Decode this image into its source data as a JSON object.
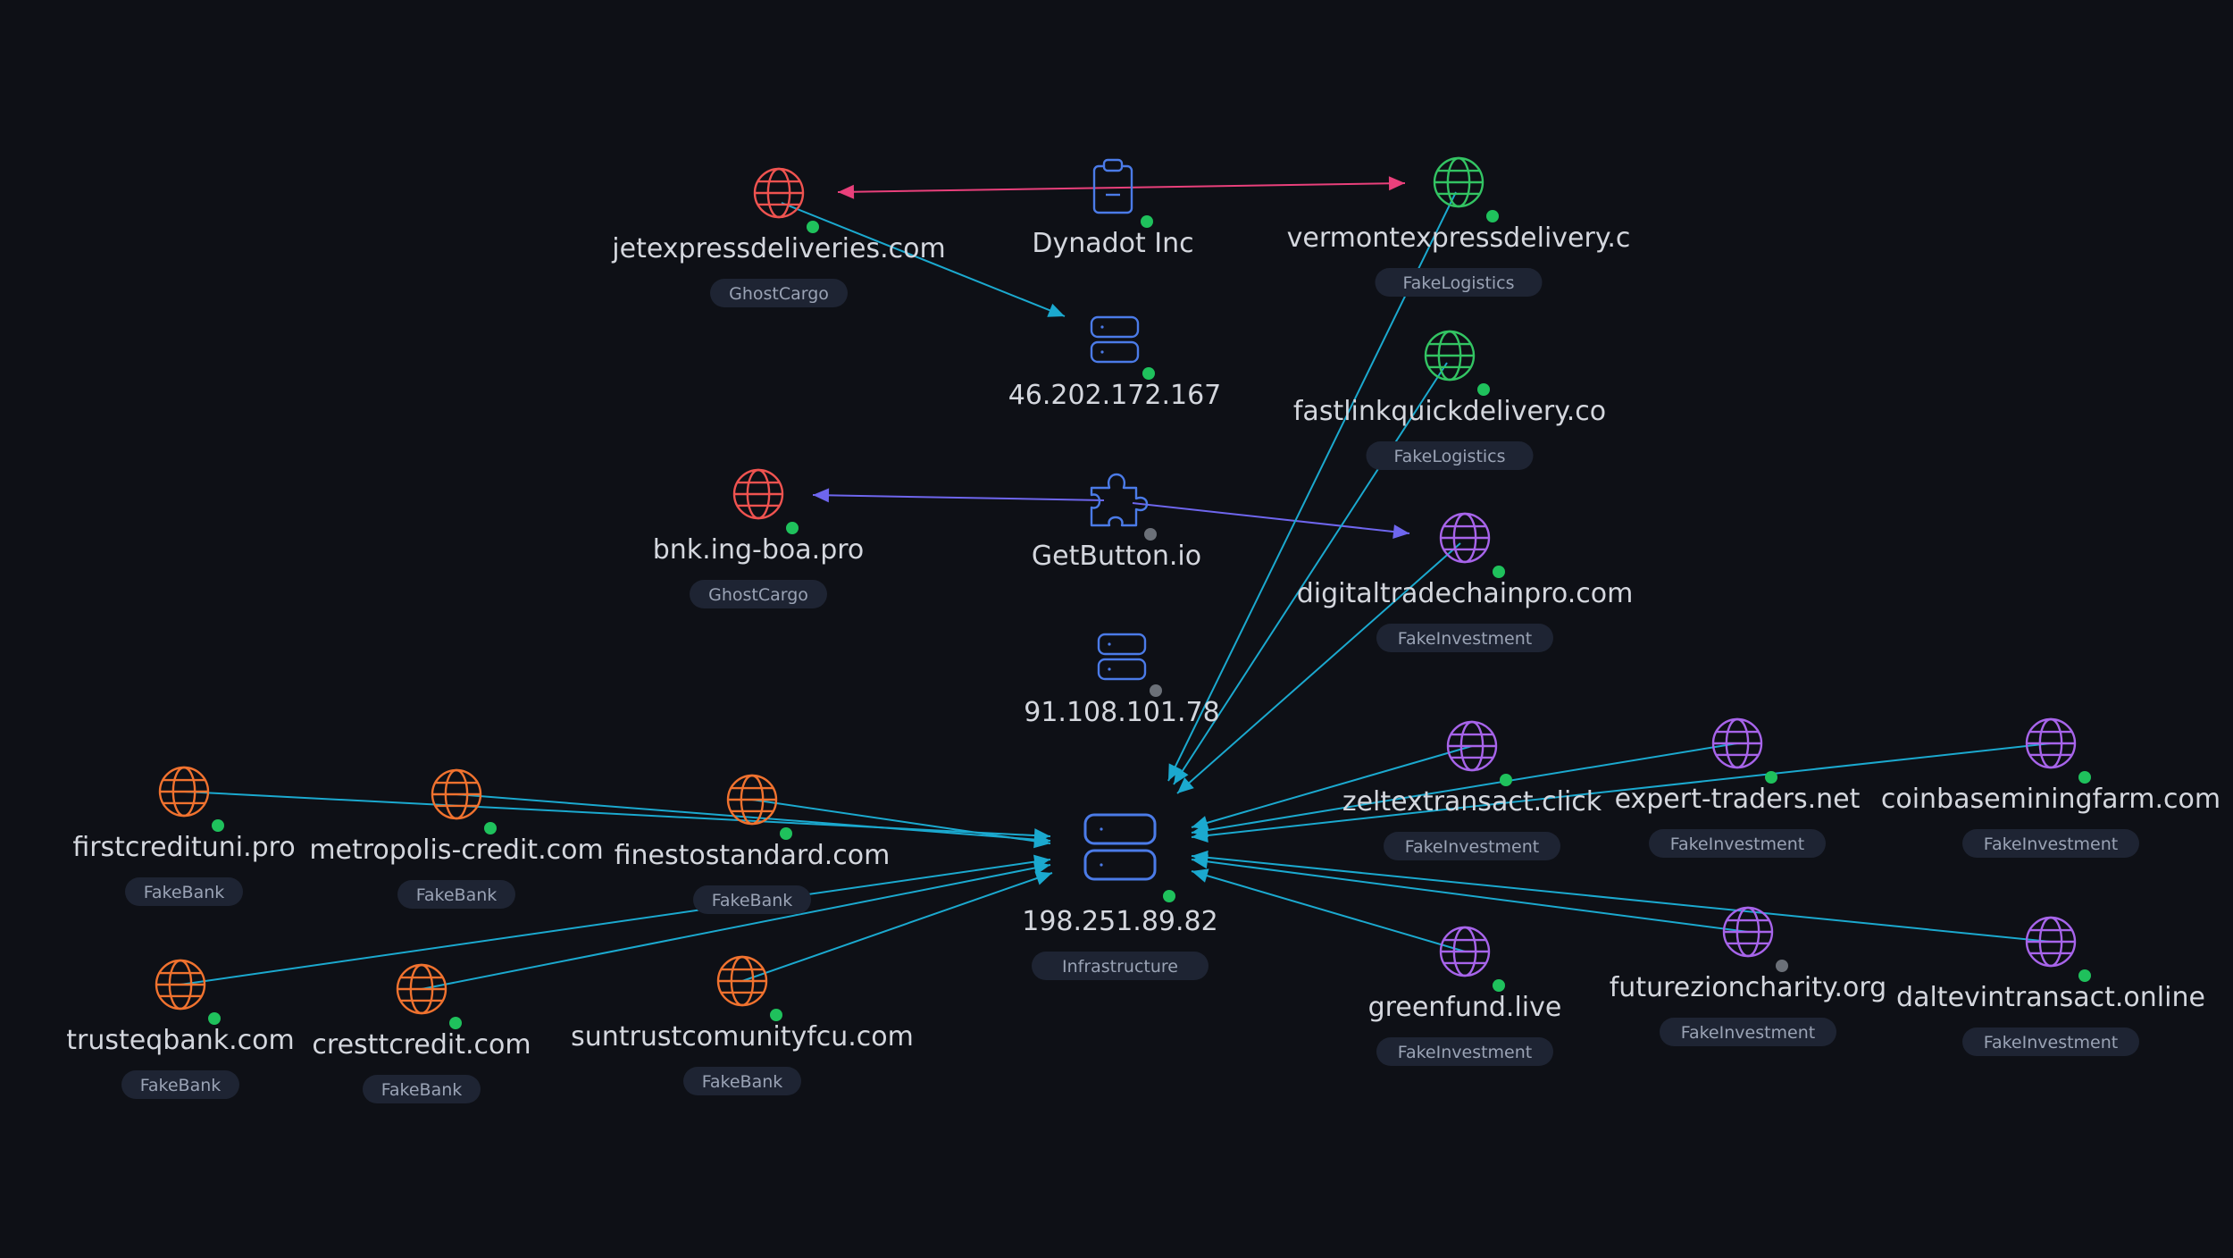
{
  "colors": {
    "background": "#0e1016",
    "domain_red": "#ef5350",
    "domain_green": "#33c463",
    "domain_orange": "#f0722f",
    "domain_purple": "#a764ea",
    "infra_blue": "#4b7be8",
    "edge_cyan": "#1ba9cf",
    "edge_pink": "#e9407b",
    "edge_violet": "#6e66ee",
    "status_green": "#1fc15c",
    "status_gray": "#6b7078",
    "tag_bg": "#1e2433",
    "tag_text": "#9aa3b5",
    "label_text": "#d4d7de"
  },
  "nodes": [
    {
      "id": "jetexpress",
      "label": "jetexpressdeliveries.com",
      "tag": "GhostCargo",
      "icon": "globe-icon",
      "color": "domain_red",
      "status": "green"
    },
    {
      "id": "dynadot",
      "label": "Dynadot Inc",
      "tag": "",
      "icon": "clipboard-icon",
      "color": "infra_blue",
      "status": "green"
    },
    {
      "id": "vermont",
      "label": "vermontexpressdelivery.c",
      "tag": "FakeLogistics",
      "icon": "globe-icon",
      "color": "domain_green",
      "status": "green"
    },
    {
      "id": "ip46",
      "label": "46.202.172.167",
      "tag": "",
      "icon": "server-icon",
      "color": "infra_blue",
      "status": "green"
    },
    {
      "id": "fastlink",
      "label": "fastlinkquickdelivery.co",
      "tag": "FakeLogistics",
      "icon": "globe-icon",
      "color": "domain_green",
      "status": "green"
    },
    {
      "id": "bnk",
      "label": "bnk.ing-boa.pro",
      "tag": "GhostCargo",
      "icon": "globe-icon",
      "color": "domain_red",
      "status": "green"
    },
    {
      "id": "getbutton",
      "label": "GetButton.io",
      "tag": "",
      "icon": "puzzle-icon",
      "color": "infra_blue",
      "status": "gray"
    },
    {
      "id": "digitaltrade",
      "label": "digitaltradechainpro.com",
      "tag": "FakeInvestment",
      "icon": "globe-icon",
      "color": "domain_purple",
      "status": "green"
    },
    {
      "id": "ip91",
      "label": "91.108.101.78",
      "tag": "",
      "icon": "server-icon",
      "color": "infra_blue",
      "status": "gray"
    },
    {
      "id": "hub",
      "label": "198.251.89.82",
      "tag": "Infrastructure",
      "icon": "server-icon",
      "color": "infra_blue",
      "status": "green"
    },
    {
      "id": "firstcredit",
      "label": "firstcredituni.pro",
      "tag": "FakeBank",
      "icon": "globe-icon",
      "color": "domain_orange",
      "status": "green"
    },
    {
      "id": "metropolis",
      "label": "metropolis-credit.com",
      "tag": "FakeBank",
      "icon": "globe-icon",
      "color": "domain_orange",
      "status": "green"
    },
    {
      "id": "finesto",
      "label": "finestostandard.com",
      "tag": "FakeBank",
      "icon": "globe-icon",
      "color": "domain_orange",
      "status": "green"
    },
    {
      "id": "trusteq",
      "label": "trusteqbank.com",
      "tag": "FakeBank",
      "icon": "globe-icon",
      "color": "domain_orange",
      "status": "green"
    },
    {
      "id": "cresttcredit",
      "label": "cresttcredit.com",
      "tag": "FakeBank",
      "icon": "globe-icon",
      "color": "domain_orange",
      "status": "green"
    },
    {
      "id": "suntrust",
      "label": "suntrustcomunityfcu.com",
      "tag": "FakeBank",
      "icon": "globe-icon",
      "color": "domain_orange",
      "status": "green"
    },
    {
      "id": "zeltex",
      "label": "zeltextransact.click",
      "tag": "FakeInvestment",
      "icon": "globe-icon",
      "color": "domain_purple",
      "status": "green"
    },
    {
      "id": "experttraders",
      "label": "expert-traders.net",
      "tag": "FakeInvestment",
      "icon": "globe-icon",
      "color": "domain_purple",
      "status": "green"
    },
    {
      "id": "coinbase",
      "label": "coinbaseminingfarm.com",
      "tag": "FakeInvestment",
      "icon": "globe-icon",
      "color": "domain_purple",
      "status": "green"
    },
    {
      "id": "greenfund",
      "label": "greenfund.live",
      "tag": "FakeInvestment",
      "icon": "globe-icon",
      "color": "domain_purple",
      "status": "green"
    },
    {
      "id": "futurezion",
      "label": "futurezioncharity.org",
      "tag": "FakeInvestment",
      "icon": "globe-icon",
      "color": "domain_purple",
      "status": "gray"
    },
    {
      "id": "daltevin",
      "label": "daltevintransact.online",
      "tag": "FakeInvestment",
      "icon": "globe-icon",
      "color": "domain_purple",
      "status": "green"
    }
  ],
  "edges": [
    {
      "from": "vermont",
      "to": "jetexpress",
      "color": "edge_pink",
      "arrow": "both"
    },
    {
      "from": "jetexpress",
      "to": "ip46",
      "color": "edge_cyan",
      "arrow": "end"
    },
    {
      "from": "getbutton",
      "to": "bnk",
      "color": "edge_violet",
      "arrow": "end"
    },
    {
      "from": "getbutton",
      "to": "digitaltrade",
      "color": "edge_violet",
      "arrow": "end"
    },
    {
      "from": "vermont",
      "to": "hub",
      "color": "edge_cyan",
      "arrow": "end"
    },
    {
      "from": "fastlink",
      "to": "hub",
      "color": "edge_cyan",
      "arrow": "end"
    },
    {
      "from": "digitaltrade",
      "to": "hub",
      "color": "edge_cyan",
      "arrow": "end"
    },
    {
      "from": "firstcredit",
      "to": "hub",
      "color": "edge_cyan",
      "arrow": "end"
    },
    {
      "from": "metropolis",
      "to": "hub",
      "color": "edge_cyan",
      "arrow": "end"
    },
    {
      "from": "finesto",
      "to": "hub",
      "color": "edge_cyan",
      "arrow": "end"
    },
    {
      "from": "trusteq",
      "to": "hub",
      "color": "edge_cyan",
      "arrow": "end"
    },
    {
      "from": "cresttcredit",
      "to": "hub",
      "color": "edge_cyan",
      "arrow": "end"
    },
    {
      "from": "suntrust",
      "to": "hub",
      "color": "edge_cyan",
      "arrow": "end"
    },
    {
      "from": "zeltex",
      "to": "hub",
      "color": "edge_cyan",
      "arrow": "end"
    },
    {
      "from": "experttraders",
      "to": "hub",
      "color": "edge_cyan",
      "arrow": "end"
    },
    {
      "from": "coinbase",
      "to": "hub",
      "color": "edge_cyan",
      "arrow": "end"
    },
    {
      "from": "greenfund",
      "to": "hub",
      "color": "edge_cyan",
      "arrow": "end"
    },
    {
      "from": "futurezion",
      "to": "hub",
      "color": "edge_cyan",
      "arrow": "end"
    },
    {
      "from": "daltevin",
      "to": "hub",
      "color": "edge_cyan",
      "arrow": "end"
    }
  ]
}
